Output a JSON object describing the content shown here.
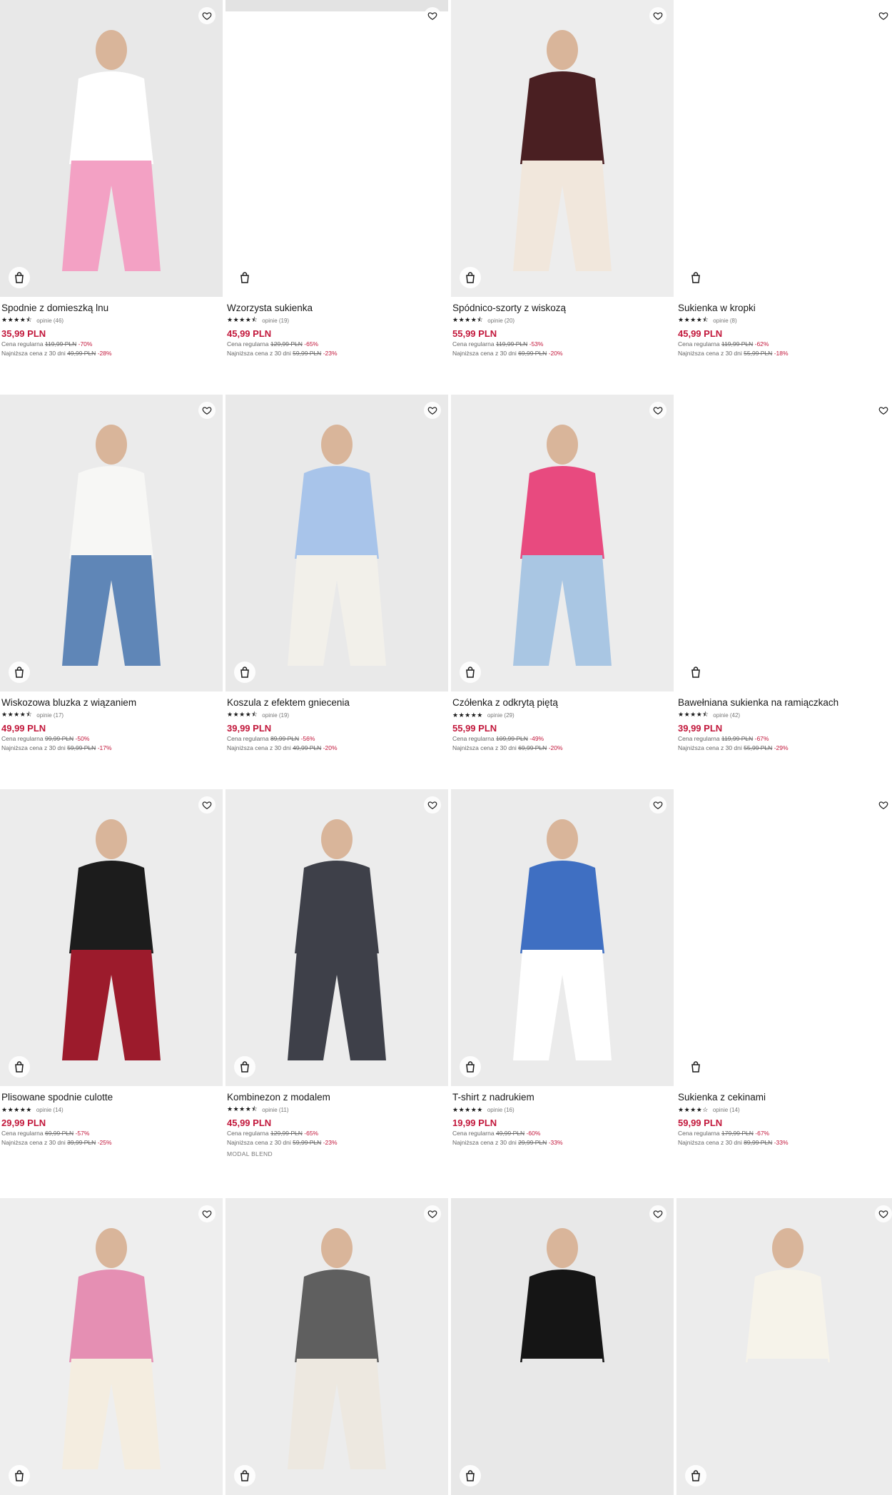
{
  "labels": {
    "regular_price": "Cena regularna",
    "lowest_price": "Najniższa cena z 30 dni",
    "reviews_word": "opinie"
  },
  "products": [
    {
      "name": "Spodnie z domieszką lnu",
      "stars": "★★★★⯪",
      "reviews": "opinie (46)",
      "price": "35,99 PLN",
      "regular_old": "119,99 PLN",
      "regular_disc": "-70%",
      "lowest_old": "49,99 PLN",
      "lowest_disc": "-28%",
      "image": "photo",
      "colors": [
        "#e8e8e8",
        "#f3a1c4",
        "#ffffff"
      ]
    },
    {
      "name": "Wzorzysta sukienka",
      "stars": "★★★★⯪",
      "reviews": "opinie (19)",
      "price": "45,99 PLN",
      "regular_old": "129,99 PLN",
      "regular_disc": "-65%",
      "lowest_old": "59,99 PLN",
      "lowest_disc": "-23%",
      "image": "blank",
      "colors": [
        "#ffffff",
        "#e0e0e0",
        "#e0e0e0"
      ]
    },
    {
      "name": "Spódnico-szorty z wiskozą",
      "stars": "★★★★⯪",
      "reviews": "opinie (20)",
      "price": "55,99 PLN",
      "regular_old": "119,99 PLN",
      "regular_disc": "-53%",
      "lowest_old": "69,99 PLN",
      "lowest_disc": "-20%",
      "image": "photo",
      "colors": [
        "#ededed",
        "#f1e7dc",
        "#4a1f22"
      ]
    },
    {
      "name": "Sukienka w kropki",
      "stars": "★★★★⯪",
      "reviews": "opinie (8)",
      "price": "45,99 PLN",
      "regular_old": "119,99 PLN",
      "regular_disc": "-62%",
      "lowest_old": "55,99 PLN",
      "lowest_disc": "-18%",
      "image": "blank",
      "colors": [
        "#ffffff",
        "#ffffff",
        "#ffffff"
      ]
    },
    {
      "name": "Wiskozowa bluzka z wiązaniem",
      "stars": "★★★★⯪",
      "reviews": "opinie (17)",
      "price": "49,99 PLN",
      "regular_old": "99,99 PLN",
      "regular_disc": "-50%",
      "lowest_old": "59,99 PLN",
      "lowest_disc": "-17%",
      "image": "photo",
      "colors": [
        "#ebebeb",
        "#5f86b7",
        "#f7f7f5"
      ]
    },
    {
      "name": "Koszula z efektem gniecenia",
      "stars": "★★★★⯪",
      "reviews": "opinie (19)",
      "price": "39,99 PLN",
      "regular_old": "89,99 PLN",
      "regular_disc": "-56%",
      "lowest_old": "49,99 PLN",
      "lowest_disc": "-20%",
      "image": "photo",
      "colors": [
        "#e9e9e9",
        "#f2f0ea",
        "#a8c4ea"
      ]
    },
    {
      "name": "Czółenka z odkrytą piętą",
      "stars": "★★★★★",
      "reviews": "opinie (29)",
      "price": "55,99 PLN",
      "regular_old": "109,99 PLN",
      "regular_disc": "-49%",
      "lowest_old": "69,99 PLN",
      "lowest_disc": "-20%",
      "image": "photo",
      "colors": [
        "#ececec",
        "#a9c6e3",
        "#e84a7f"
      ]
    },
    {
      "name": "Bawełniana sukienka na ramiączkach",
      "stars": "★★★★⯪",
      "reviews": "opinie (42)",
      "price": "39,99 PLN",
      "regular_old": "119,99 PLN",
      "regular_disc": "-67%",
      "lowest_old": "55,99 PLN",
      "lowest_disc": "-29%",
      "image": "blank",
      "colors": [
        "#ffffff",
        "#ffffff",
        "#ffffff"
      ]
    },
    {
      "name": "Plisowane spodnie culotte",
      "stars": "★★★★★",
      "reviews": "opinie (14)",
      "price": "29,99 PLN",
      "regular_old": "69,99 PLN",
      "regular_disc": "-57%",
      "lowest_old": "39,99 PLN",
      "lowest_disc": "-25%",
      "image": "photo",
      "colors": [
        "#ececec",
        "#9c1b2c",
        "#1c1c1c"
      ]
    },
    {
      "name": "Kombinezon z modalem",
      "stars": "★★★★⯪",
      "reviews": "opinie (11)",
      "price": "45,99 PLN",
      "regular_old": "129,99 PLN",
      "regular_disc": "-65%",
      "lowest_old": "59,99 PLN",
      "lowest_disc": "-23%",
      "image": "photo",
      "tag": "MODAL BLEND",
      "colors": [
        "#ececec",
        "#3e4049",
        "#3e4049"
      ]
    },
    {
      "name": "T-shirt z nadrukiem",
      "stars": "★★★★★",
      "reviews": "opinie (16)",
      "price": "19,99 PLN",
      "regular_old": "49,99 PLN",
      "regular_disc": "-60%",
      "lowest_old": "29,99 PLN",
      "lowest_disc": "-33%",
      "image": "photo",
      "colors": [
        "#ebebeb",
        "#ffffff",
        "#3f6fc2"
      ]
    },
    {
      "name": "Sukienka z cekinami",
      "stars": "★★★★☆",
      "reviews": "opinie (14)",
      "price": "59,99 PLN",
      "regular_old": "179,99 PLN",
      "regular_disc": "-67%",
      "lowest_old": "89,99 PLN",
      "lowest_disc": "-33%",
      "image": "blank",
      "colors": [
        "#ffffff",
        "#ffffff",
        "#ffffff"
      ]
    },
    {
      "name": "",
      "stars": "",
      "reviews": "",
      "price": "",
      "regular_old": "",
      "regular_disc": "",
      "lowest_old": "",
      "lowest_disc": "",
      "image": "photo",
      "colors": [
        "#eeeeee",
        "#f4ede0",
        "#e58fb3"
      ]
    },
    {
      "name": "",
      "stars": "",
      "reviews": "",
      "price": "",
      "regular_old": "",
      "regular_disc": "",
      "lowest_old": "",
      "lowest_disc": "",
      "image": "photo",
      "colors": [
        "#ececec",
        "#ede8e0",
        "#5f5f5f"
      ]
    },
    {
      "name": "",
      "stars": "",
      "reviews": "",
      "price": "",
      "regular_old": "",
      "regular_disc": "",
      "lowest_old": "",
      "lowest_disc": "",
      "image": "photo",
      "colors": [
        "#e8e8e8",
        "#e8e8e8",
        "#151515"
      ]
    },
    {
      "name": "",
      "stars": "",
      "reviews": "",
      "price": "",
      "regular_old": "",
      "regular_disc": "",
      "lowest_old": "",
      "lowest_disc": "",
      "image": "photo",
      "colors": [
        "#ececec",
        "#ececec",
        "#f6f3ea"
      ]
    }
  ]
}
